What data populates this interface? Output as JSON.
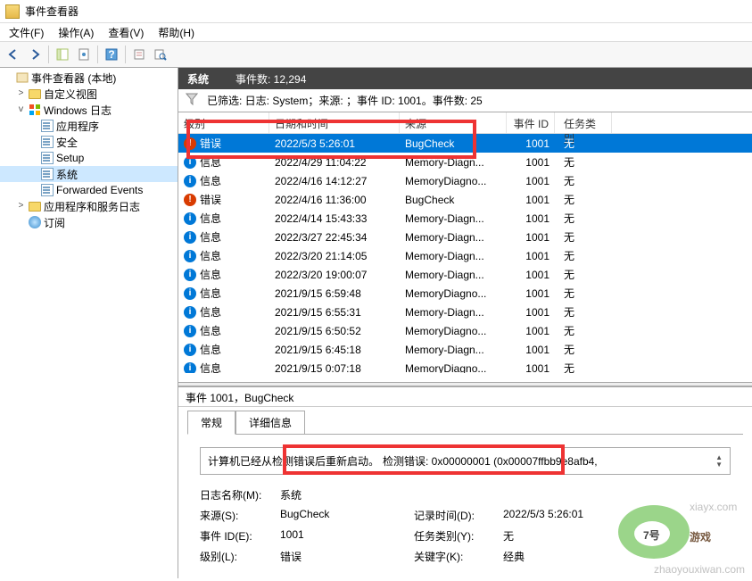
{
  "window": {
    "title": "事件查看器"
  },
  "menu": {
    "file": "文件(F)",
    "action": "操作(A)",
    "view": "查看(V)",
    "help": "帮助(H)"
  },
  "tree": {
    "root": "事件查看器 (本地)",
    "custom": "自定义视图",
    "winlogs": "Windows 日志",
    "app": "应用程序",
    "security": "安全",
    "setup": "Setup",
    "system": "系统",
    "forwarded": "Forwarded Events",
    "appsvc": "应用程序和服务日志",
    "subscribe": "订阅"
  },
  "header": {
    "title": "系统",
    "count_label": "事件数: 12,294"
  },
  "filter": {
    "text": "已筛选: 日志: System；来源: ；事件 ID: 1001。事件数: 25"
  },
  "cols": {
    "level": "级别",
    "date": "日期和时间",
    "source": "来源",
    "id": "事件 ID",
    "taskcat": "任务类别"
  },
  "rows": [
    {
      "lv": "err",
      "level": "错误",
      "date": "2022/5/3 5:26:01",
      "source": "BugCheck",
      "id": "1001",
      "task": "无",
      "sel": true
    },
    {
      "lv": "info",
      "level": "信息",
      "date": "2022/4/29 11:04:22",
      "source": "Memory-Diagn...",
      "id": "1001",
      "task": "无"
    },
    {
      "lv": "info",
      "level": "信息",
      "date": "2022/4/16 14:12:27",
      "source": "MemoryDiagno...",
      "id": "1001",
      "task": "无"
    },
    {
      "lv": "err",
      "level": "错误",
      "date": "2022/4/16 11:36:00",
      "source": "BugCheck",
      "id": "1001",
      "task": "无"
    },
    {
      "lv": "info",
      "level": "信息",
      "date": "2022/4/14 15:43:33",
      "source": "Memory-Diagn...",
      "id": "1001",
      "task": "无"
    },
    {
      "lv": "info",
      "level": "信息",
      "date": "2022/3/27 22:45:34",
      "source": "Memory-Diagn...",
      "id": "1001",
      "task": "无"
    },
    {
      "lv": "info",
      "level": "信息",
      "date": "2022/3/20 21:14:05",
      "source": "Memory-Diagn...",
      "id": "1001",
      "task": "无"
    },
    {
      "lv": "info",
      "level": "信息",
      "date": "2022/3/20 19:00:07",
      "source": "Memory-Diagn...",
      "id": "1001",
      "task": "无"
    },
    {
      "lv": "info",
      "level": "信息",
      "date": "2021/9/15 6:59:48",
      "source": "MemoryDiagno...",
      "id": "1001",
      "task": "无"
    },
    {
      "lv": "info",
      "level": "信息",
      "date": "2021/9/15 6:55:31",
      "source": "Memory-Diagn...",
      "id": "1001",
      "task": "无"
    },
    {
      "lv": "info",
      "level": "信息",
      "date": "2021/9/15 6:50:52",
      "source": "MemoryDiagno...",
      "id": "1001",
      "task": "无"
    },
    {
      "lv": "info",
      "level": "信息",
      "date": "2021/9/15 6:45:18",
      "source": "Memory-Diagn...",
      "id": "1001",
      "task": "无"
    },
    {
      "lv": "info",
      "level": "信息",
      "date": "2021/9/15 0:07:18",
      "source": "MemoryDiagno...",
      "id": "1001",
      "task": "无"
    }
  ],
  "detail": {
    "title": "事件 1001，BugCheck",
    "tab_general": "常规",
    "tab_details": "详细信息",
    "message_a": "计算机已经从检测错误后重新启动。",
    "message_b": "检测错误: 0x00000001 (0x00007ffbb9e8afb4,",
    "labels": {
      "logname": "日志名称(M):",
      "source": "来源(S):",
      "eventid": "事件 ID(E):",
      "level": "级别(L):",
      "logged": "记录时间(D):",
      "taskcat": "任务类别(Y):",
      "keywords": "关键字(K):"
    },
    "values": {
      "logname": "系统",
      "source": "BugCheck",
      "eventid": "1001",
      "level": "错误",
      "logged": "2022/5/3 5:26:01",
      "taskcat": "无",
      "keywords": "经典"
    }
  },
  "watermark": {
    "brand": "7号",
    "suffix": "游戏",
    "url1": "xiayx.com",
    "url2": "zhaoyouxiwan.com"
  }
}
